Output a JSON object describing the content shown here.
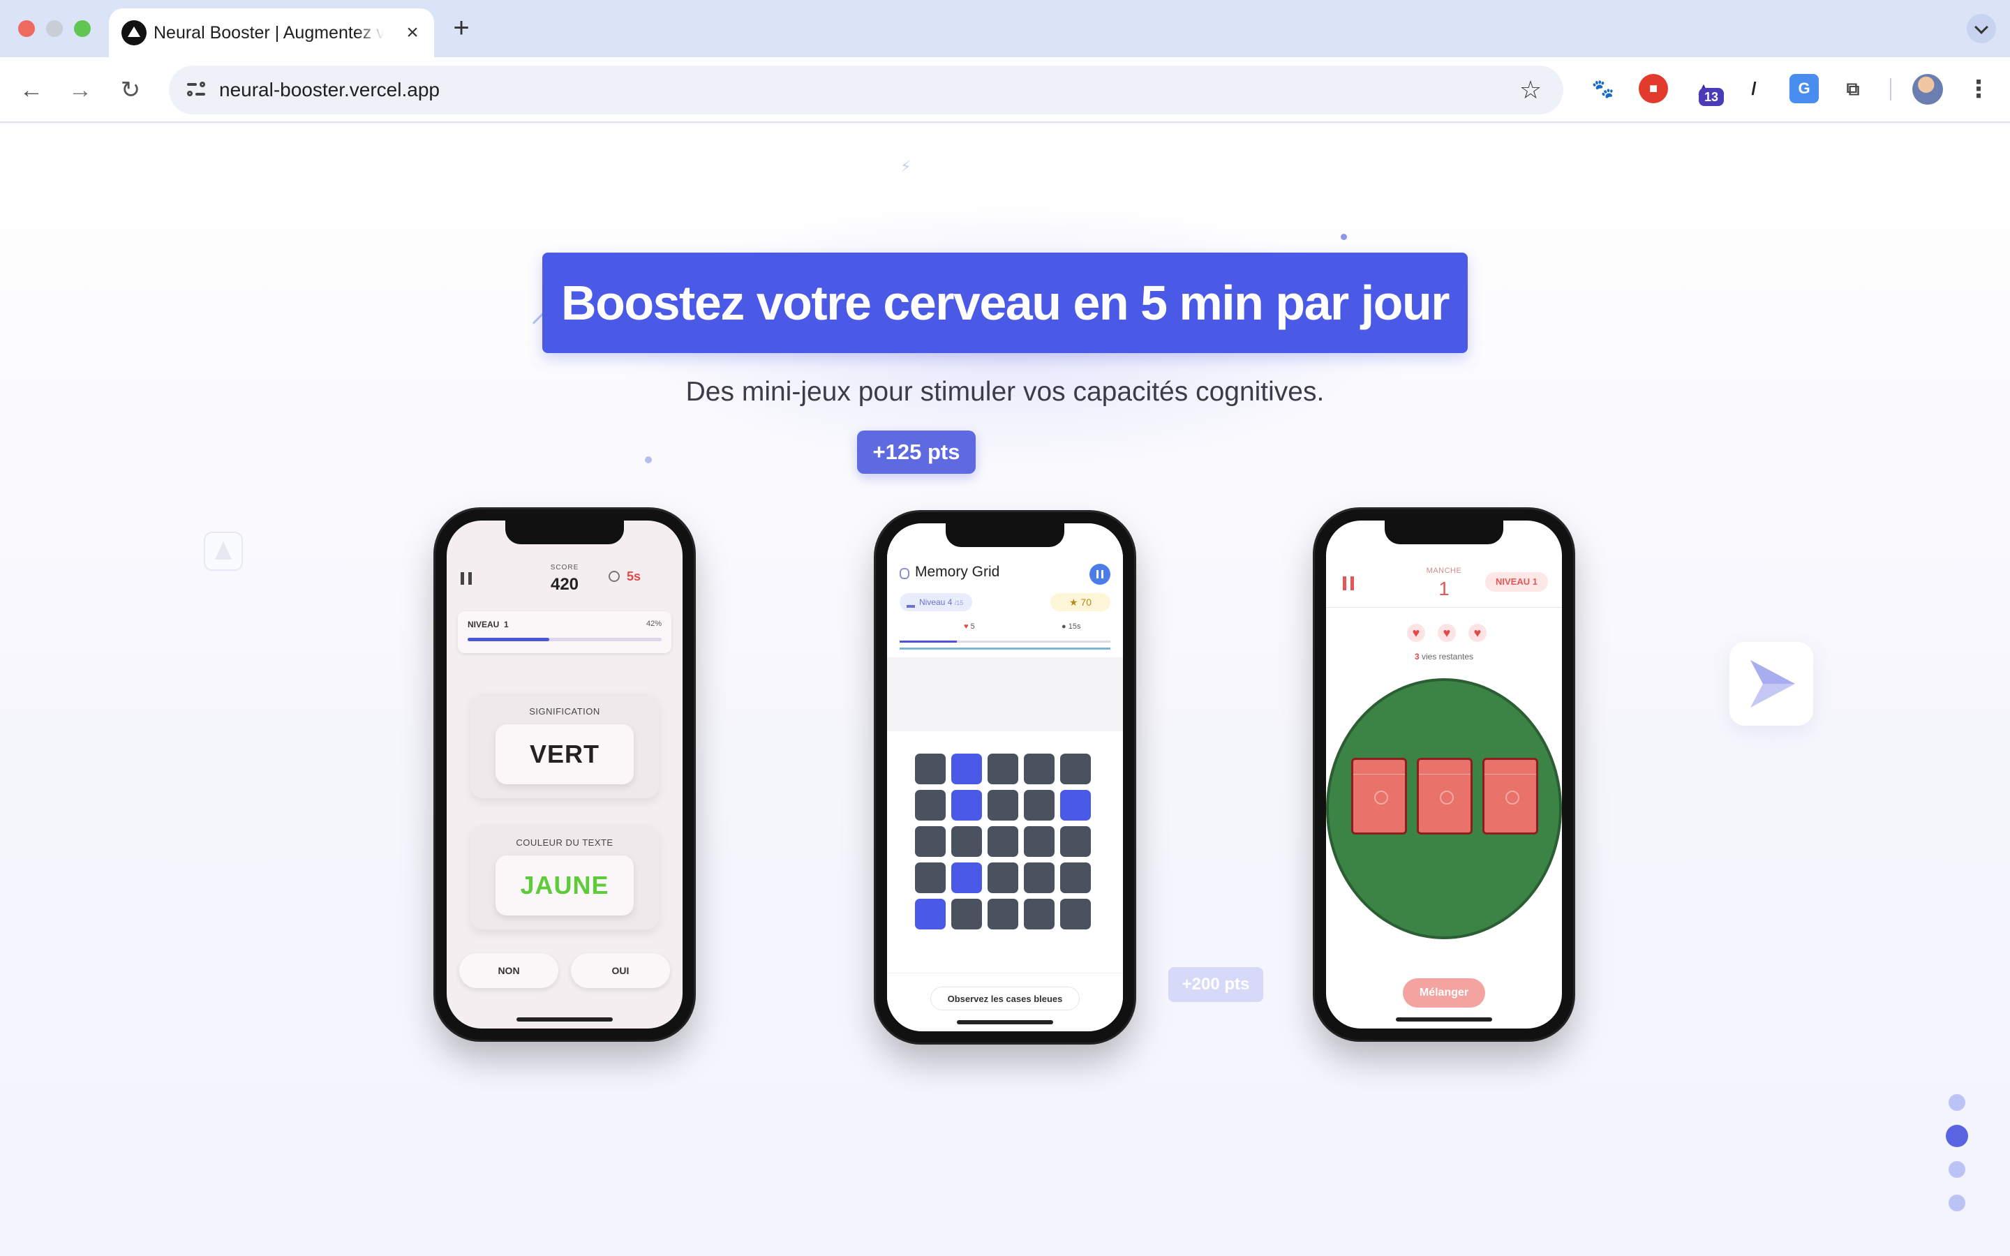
{
  "browser": {
    "tab_title": "Neural Booster | Augmentez votre",
    "tab_close": "×",
    "new_tab": "+",
    "url": "neural-booster.vercel.app",
    "bookmark": "☆",
    "nav_back": "←",
    "nav_forward": "→",
    "nav_reload": "↻",
    "menu": "⋮",
    "extensions": [
      "pet-extension-icon",
      "ublock-icon",
      "graduation-cap-icon",
      "eyedropper-icon",
      "translate-icon",
      "puzzle-icon"
    ],
    "extension_badge": "13"
  },
  "hero": {
    "title": "Boostez votre cerveau en 5 min par jour",
    "subtitle": "Des mini-jeux pour stimuler vos capacités cognitives.",
    "points_badge": "+125 pts",
    "points_badge_2": "+200 pts",
    "accent_color": "#4a5ae6"
  },
  "phone1": {
    "score_label": "SCORE",
    "score": "420",
    "timer": "5s",
    "level_label": "NIVEAU",
    "level": "1",
    "level_pct": "42%",
    "level_progress": 0.42,
    "card1_label": "SIGNIFICATION",
    "card1_word": "VERT",
    "card2_label": "COULEUR DU TEXTE",
    "card2_word": "JAUNE",
    "card2_word_color": "#5ecb3a",
    "btn_no": "NON",
    "btn_yes": "OUI"
  },
  "phone2": {
    "title": "Memory Grid",
    "level": "Niveau 4",
    "level_suffix": "/15",
    "stars": "★ 70",
    "lives": "5",
    "time": "15s",
    "progress": 0.27,
    "grid_rows": 5,
    "grid_cols": 5,
    "blue_cells": [
      1,
      6,
      9,
      16,
      20
    ],
    "hint": "Observez les cases bleues"
  },
  "phone3": {
    "round_label": "MANCHE",
    "round": "1",
    "level": "NIVEAU 1",
    "hearts": 3,
    "lives_count": "3",
    "lives_text": "vies restantes",
    "cups": 3,
    "shuffle_button": "Mélanger"
  },
  "pagination": {
    "count": 4,
    "active_index": 1
  }
}
